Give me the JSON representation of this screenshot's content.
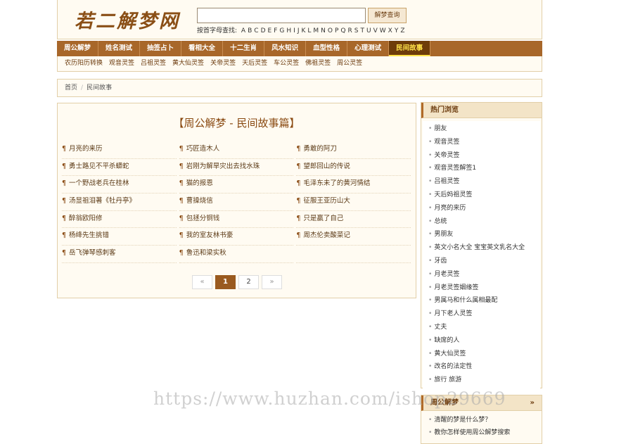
{
  "header": {
    "logo_text": "若二解梦网",
    "search_placeholder": "",
    "search_button": "解梦查询",
    "letters_label": "按首字母查找:",
    "letters": [
      "A",
      "B",
      "C",
      "D",
      "E",
      "F",
      "G",
      "H",
      "I",
      "J",
      "K",
      "L",
      "M",
      "N",
      "O",
      "P",
      "Q",
      "R",
      "S",
      "T",
      "U",
      "V",
      "W",
      "X",
      "Y",
      "Z"
    ]
  },
  "nav": [
    "周公解梦",
    "姓名测试",
    "抽签占卜",
    "看相大全",
    "十二生肖",
    "风水知识",
    "血型性格",
    "心理测试",
    "民间故事"
  ],
  "nav_active_index": 8,
  "subnav": [
    "农历阳历转换",
    "观音灵签",
    "吕祖灵签",
    "黄大仙灵签",
    "关帝灵签",
    "天后灵签",
    "车公灵签",
    "佛祖灵签",
    "周公灵签"
  ],
  "breadcrumb": {
    "home": "首页",
    "separator": "/",
    "current": "民间故事"
  },
  "main": {
    "title": "【周公解梦 - 民间故事篇】",
    "bullet": "¶",
    "rows": [
      [
        "月亮的来历",
        "巧匠造木人",
        "勇敢的阿刀"
      ],
      [
        "勇士路见不平杀蟒蛇",
        "岩刚为解旱灾出去找水珠",
        "望郎回山的传说"
      ],
      [
        "一个野战老兵在桂林",
        "猫的报恩",
        "毛泽东未了的黄河情结"
      ],
      [
        "汤显祖泪著《牡丹亭》",
        "曹操烧信",
        "征服王亚历山大"
      ],
      [
        "醉翁欧阳修",
        "包拯分铜钱",
        "只是赢了自己"
      ],
      [
        "杨绛先生挑错",
        "我的室友林书豪",
        "周杰伦卖酸菜记"
      ],
      [
        "岳飞弹琴感刺客",
        "鲁迅和梁实秋",
        ""
      ]
    ],
    "pager": {
      "prev": "«",
      "pages": [
        "1",
        "2"
      ],
      "current": "1",
      "next": "»"
    }
  },
  "sidebar": {
    "title": "热门浏览",
    "bullet": "•",
    "items": [
      "朋友",
      "观音灵签",
      "关帝灵签",
      "观音灵签解签1",
      "吕祖灵签",
      "天后妈祖灵签",
      "月亮的来历",
      "总统",
      "男朋友",
      "英文小名大全 宝宝英文乳名大全",
      "牙齿",
      "月老灵签",
      "月老灵签姻缘签",
      "男属马和什么属相最配",
      "月下老人灵签",
      "丈夫",
      "缺席的人",
      "黄大仙灵签",
      "改名的法定性",
      "旅行 旅游"
    ]
  },
  "sidebar2": {
    "title": "周公解梦",
    "more": "»",
    "items": [
      "清醒的梦是什么梦？",
      "教你怎样使用周公解梦搜索"
    ]
  },
  "watermark": "https://www.huzhan.com/ishop29669",
  "colors": {
    "accent": "#a8672a",
    "active_nav_text": "#ffe24a",
    "panel_bg": "#fffbf2",
    "border": "#e2cfa8"
  }
}
